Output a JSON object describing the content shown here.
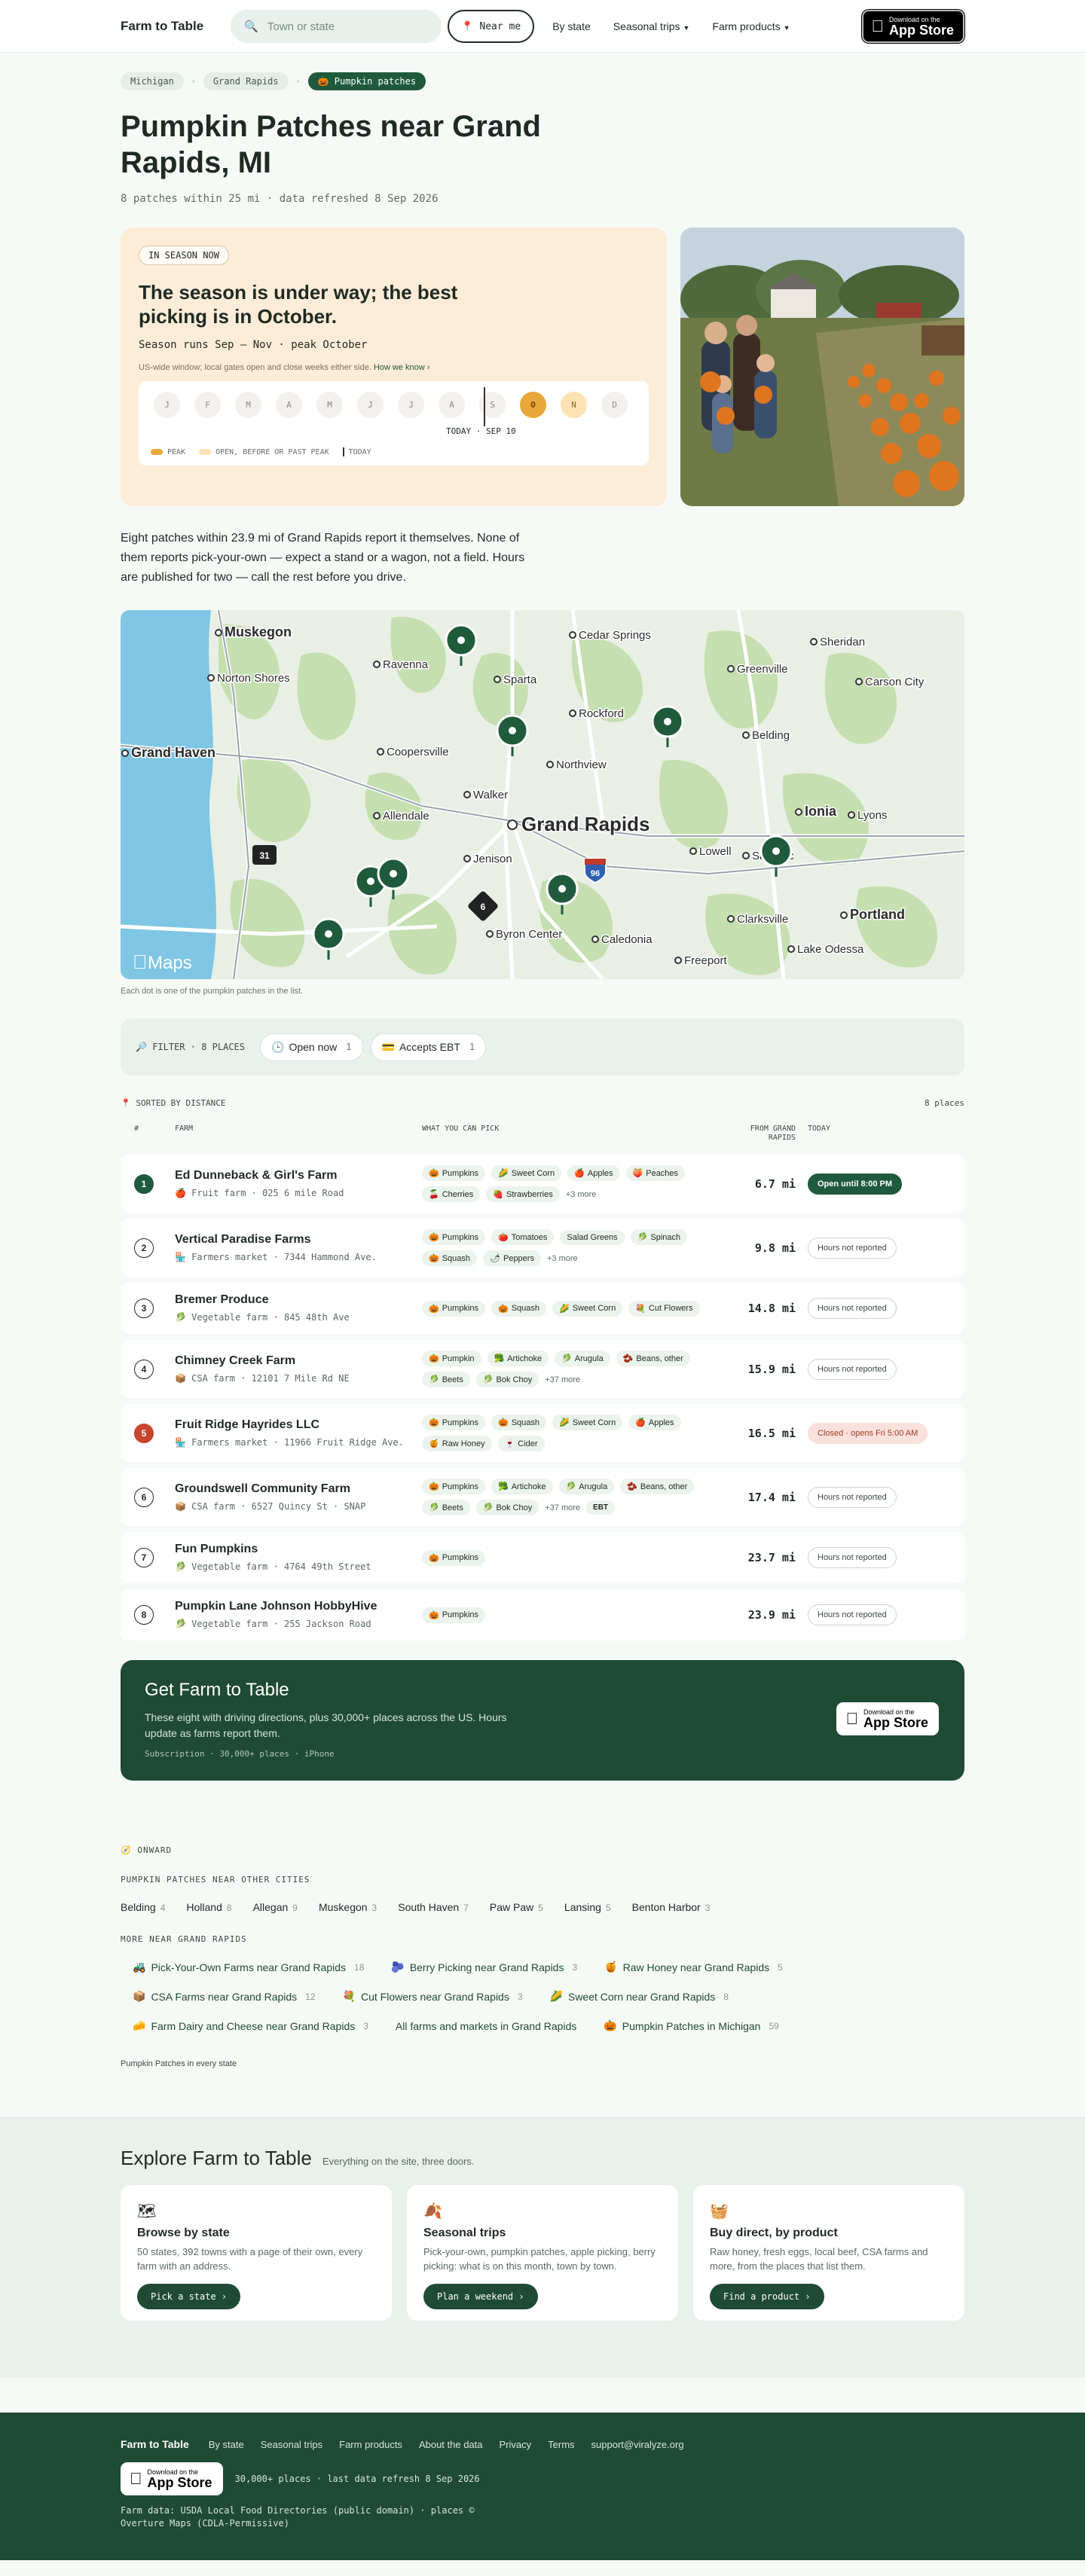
{
  "header": {
    "logo": "Farm to Table",
    "search_placeholder": "Town or state",
    "near_me": "Near me",
    "nav": [
      {
        "label": "By state",
        "has_menu": false
      },
      {
        "label": "Seasonal trips",
        "has_menu": true
      },
      {
        "label": "Farm products",
        "has_menu": true
      }
    ],
    "appstore": {
      "line1": "Download on the",
      "line2": "App Store"
    }
  },
  "breadcrumb": {
    "items": [
      "Michigan",
      "Grand Rapids"
    ],
    "current": "🎃 Pumpkin patches"
  },
  "page": {
    "title": "Pumpkin Patches near Grand Rapids, MI",
    "subline": "8 patches within 25 mi · data refreshed 8 Sep 2026"
  },
  "season": {
    "badge": "IN SEASON NOW",
    "headline": "The season is under way; the best picking is in October.",
    "runs": "Season runs Sep – Nov · peak October",
    "note": "US-wide window; local gates open and close weeks either side.",
    "note_link": "How we know ›",
    "months": [
      {
        "label": "J",
        "state": "off"
      },
      {
        "label": "F",
        "state": "off"
      },
      {
        "label": "M",
        "state": "off"
      },
      {
        "label": "A",
        "state": "off"
      },
      {
        "label": "M",
        "state": "off"
      },
      {
        "label": "J",
        "state": "off"
      },
      {
        "label": "J",
        "state": "off"
      },
      {
        "label": "A",
        "state": "off"
      },
      {
        "label": "S",
        "state": "off"
      },
      {
        "label": "O",
        "state": "peak"
      },
      {
        "label": "N",
        "state": "open"
      },
      {
        "label": "D",
        "state": "off"
      }
    ],
    "today_label": "TODAY · SEP 10",
    "legend": {
      "peak": "PEAK",
      "open": "OPEN, BEFORE OR PAST PEAK",
      "today": "TODAY"
    }
  },
  "intro": "Eight patches within 23.9 mi of Grand Rapids report it themselves. None of them reports pick-your-own — expect a stand or a wagon, not a field. Hours are published for two — call the rest before you drive.",
  "map": {
    "attribution": "Maps",
    "caption": "Each dot is one of the pumpkin patches in the list.",
    "places": [
      "Muskegon",
      "Norton Shores",
      "Grand Haven",
      "Ravenna",
      "Sparta",
      "Cedar Springs",
      "Sheridan",
      "Greenville",
      "Carson City",
      "Rockford",
      "Belding",
      "Coopersville",
      "Northview",
      "Walker",
      "Grand Rapids",
      "Allendale",
      "Jenison",
      "Lowell",
      "Saranac",
      "Ionia",
      "Lyons",
      "Byron Center",
      "Caledonia",
      "Clarksville",
      "Portland",
      "Freeport",
      "Lake Odessa"
    ],
    "highway_labels": [
      "31",
      "96",
      "6"
    ]
  },
  "filter": {
    "label": "FILTER · 8 PLACES",
    "chips": [
      {
        "icon": "🕒",
        "label": "Open now",
        "count": "1"
      },
      {
        "icon": "💳",
        "label": "Accepts EBT",
        "count": "1"
      }
    ]
  },
  "list": {
    "sorted_label": "SORTED BY DISTANCE",
    "count_label": "8 places",
    "columns": {
      "num": "#",
      "farm": "FARM",
      "pick": "WHAT YOU CAN PICK",
      "dist": "FROM GRAND RAPIDS",
      "today": "TODAY"
    },
    "rows": [
      {
        "n": "1",
        "badge": "open",
        "name": "Ed Dunneback & Girl's Farm",
        "meta": "🍎 Fruit farm · 025 6 mile Road",
        "tags": [
          {
            "i": "🎃",
            "t": "Pumpkins"
          },
          {
            "i": "🌽",
            "t": "Sweet Corn"
          },
          {
            "i": "🍎",
            "t": "Apples"
          },
          {
            "i": "🍑",
            "t": "Peaches"
          },
          {
            "i": "🍒",
            "t": "Cherries"
          },
          {
            "i": "🍓",
            "t": "Strawberries"
          }
        ],
        "more": "+3 more",
        "dist": "6.7 mi",
        "status": "Open until 8:00 PM",
        "status_type": "open"
      },
      {
        "n": "2",
        "badge": "",
        "name": "Vertical Paradise Farms",
        "meta": "🏪 Farmers market · 7344 Hammond Ave.",
        "tags": [
          {
            "i": "🎃",
            "t": "Pumpkins"
          },
          {
            "i": "🍅",
            "t": "Tomatoes"
          },
          {
            "i": "",
            "t": "Salad Greens"
          },
          {
            "i": "🥬",
            "t": "Spinach"
          },
          {
            "i": "🎃",
            "t": "Squash"
          },
          {
            "i": "🌶",
            "t": "Peppers"
          }
        ],
        "more": "+3 more",
        "dist": "9.8 mi",
        "status": "Hours not reported",
        "status_type": "none"
      },
      {
        "n": "3",
        "badge": "",
        "name": "Bremer Produce",
        "meta": "🥬 Vegetable farm · 845 48th Ave",
        "tags": [
          {
            "i": "🎃",
            "t": "Pumpkins"
          },
          {
            "i": "🎃",
            "t": "Squash"
          },
          {
            "i": "🌽",
            "t": "Sweet Corn"
          },
          {
            "i": "💐",
            "t": "Cut Flowers"
          }
        ],
        "more": "",
        "dist": "14.8 mi",
        "status": "Hours not reported",
        "status_type": "none"
      },
      {
        "n": "4",
        "badge": "",
        "name": "Chimney Creek Farm",
        "meta": "📦 CSA farm · 12101 7 Mile Rd NE",
        "tags": [
          {
            "i": "🎃",
            "t": "Pumpkin"
          },
          {
            "i": "🥦",
            "t": "Artichoke"
          },
          {
            "i": "🥬",
            "t": "Arugula"
          },
          {
            "i": "🫘",
            "t": "Beans, other"
          },
          {
            "i": "🥬",
            "t": "Beets"
          },
          {
            "i": "🥬",
            "t": "Bok Choy"
          }
        ],
        "more": "+37 more",
        "dist": "15.9 mi",
        "status": "Hours not reported",
        "status_type": "none"
      },
      {
        "n": "5",
        "badge": "closed",
        "name": "Fruit Ridge Hayrides LLC",
        "meta": "🏪 Farmers market · 11966 Fruit Ridge Ave.",
        "tags": [
          {
            "i": "🎃",
            "t": "Pumpkins"
          },
          {
            "i": "🎃",
            "t": "Squash"
          },
          {
            "i": "🌽",
            "t": "Sweet Corn"
          },
          {
            "i": "🍎",
            "t": "Apples"
          },
          {
            "i": "🍯",
            "t": "Raw Honey"
          },
          {
            "i": "🍷",
            "t": "Cider"
          }
        ],
        "more": "",
        "dist": "16.5 mi",
        "status": "Closed · opens Fri 5:00 AM",
        "status_type": "closed"
      },
      {
        "n": "6",
        "badge": "",
        "name": "Groundswell Community Farm",
        "meta": "📦 CSA farm · 6527 Quincy St · SNAP",
        "tags": [
          {
            "i": "🎃",
            "t": "Pumpkins"
          },
          {
            "i": "🥦",
            "t": "Artichoke"
          },
          {
            "i": "🥬",
            "t": "Arugula"
          },
          {
            "i": "🫘",
            "t": "Beans, other"
          },
          {
            "i": "🥬",
            "t": "Beets"
          },
          {
            "i": "🥬",
            "t": "Bok Choy"
          }
        ],
        "more": "+37 more",
        "extra_tag": "EBT",
        "dist": "17.4 mi",
        "status": "Hours not reported",
        "status_type": "none"
      },
      {
        "n": "7",
        "badge": "",
        "name": "Fun Pumpkins",
        "meta": "🥬 Vegetable farm · 4764 49th Street",
        "tags": [
          {
            "i": "🎃",
            "t": "Pumpkins"
          }
        ],
        "more": "",
        "dist": "23.7 mi",
        "status": "Hours not reported",
        "status_type": "none"
      },
      {
        "n": "8",
        "badge": "",
        "name": "Pumpkin Lane Johnson HobbyHive",
        "meta": "🥬 Vegetable farm · 255 Jackson Road",
        "tags": [
          {
            "i": "🎃",
            "t": "Pumpkins"
          }
        ],
        "more": "",
        "dist": "23.9 mi",
        "status": "Hours not reported",
        "status_type": "none"
      }
    ]
  },
  "cta": {
    "title": "Get Farm to Table",
    "body": "These eight with driving directions, plus 30,000+ places across the US. Hours update as farms report them.",
    "sub": "Subscription · 30,000+ places · iPhone"
  },
  "onward": {
    "kicker": "ONWARD",
    "cities_label": "PUMPKIN PATCHES NEAR OTHER CITIES",
    "cities": [
      {
        "name": "Belding",
        "n": "4"
      },
      {
        "name": "Holland",
        "n": "8"
      },
      {
        "name": "Allegan",
        "n": "9"
      },
      {
        "name": "Muskegon",
        "n": "3"
      },
      {
        "name": "South Haven",
        "n": "7"
      },
      {
        "name": "Paw Paw",
        "n": "5"
      },
      {
        "name": "Lansing",
        "n": "5"
      },
      {
        "name": "Benton Harbor",
        "n": "3"
      }
    ],
    "more_label": "MORE NEAR GRAND RAPIDS",
    "links": [
      {
        "i": "🚜",
        "t": "Pick-Your-Own Farms near Grand Rapids",
        "n": "18"
      },
      {
        "i": "🫐",
        "t": "Berry Picking near Grand Rapids",
        "n": "3"
      },
      {
        "i": "🍯",
        "t": "Raw Honey near Grand Rapids",
        "n": "5"
      },
      {
        "i": "📦",
        "t": "CSA Farms near Grand Rapids",
        "n": "12"
      },
      {
        "i": "💐",
        "t": "Cut Flowers near Grand Rapids",
        "n": "3"
      },
      {
        "i": "🌽",
        "t": "Sweet Corn near Grand Rapids",
        "n": "8"
      },
      {
        "i": "🧀",
        "t": "Farm Dairy and Cheese near Grand Rapids",
        "n": "3"
      },
      {
        "i": "",
        "t": "All farms and markets in Grand Rapids",
        "n": ""
      },
      {
        "i": "🎃",
        "t": "Pumpkin Patches in Michigan",
        "n": "59"
      }
    ],
    "every": "Pumpkin Patches in every state"
  },
  "explore": {
    "title": "Explore Farm to Table",
    "tagline": "Everything on the site, three doors.",
    "cards": [
      {
        "icon": "🗺",
        "title": "Browse by state",
        "body": "50 states, 392 towns with a page of their own, every farm with an address.",
        "btn": "Pick a state ›"
      },
      {
        "icon": "🍂",
        "title": "Seasonal trips",
        "body": "Pick-your-own, pumpkin patches, apple picking, berry picking: what is on this month, town by town.",
        "btn": "Plan a weekend ›"
      },
      {
        "icon": "🧺",
        "title": "Buy direct, by product",
        "body": "Raw honey, fresh eggs, local beef, CSA farms and more, from the places that list them.",
        "btn": "Find a product ›"
      }
    ]
  },
  "footer": {
    "logo": "Farm to Table",
    "links": [
      "By state",
      "Seasonal trips",
      "Farm products",
      "About the data",
      "Privacy",
      "Terms",
      "support@viralyze.org"
    ],
    "stats": "30,000+ places · last data refresh 8 Sep 2026",
    "sources": "Farm data: USDA Local Food Directories (public domain) · places © Overture Maps (CDLA-Permissive)"
  },
  "colors": {
    "brand_green": "#1f5a3c",
    "dark_green": "#1f4a33",
    "peak": "#e8a73a",
    "season_bg": "#fdecd7",
    "closed": "#c9442e"
  }
}
